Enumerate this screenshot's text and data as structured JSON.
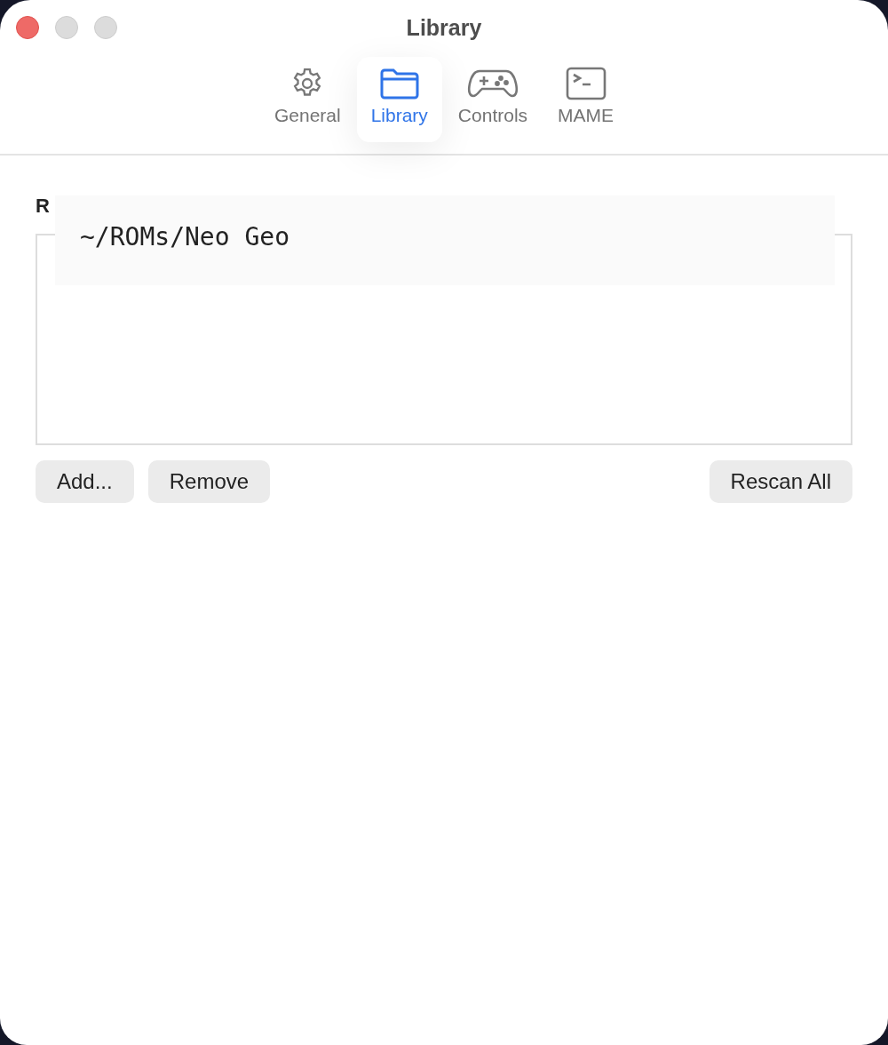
{
  "window": {
    "title": "Library"
  },
  "tabs": [
    {
      "label": "General",
      "selected": false
    },
    {
      "label": "Library",
      "selected": true
    },
    {
      "label": "Controls",
      "selected": false
    },
    {
      "label": "MAME",
      "selected": false
    }
  ],
  "section": {
    "heading": "R"
  },
  "tooltip": {
    "text": "~/ROMs/Neo Geo"
  },
  "left_buttons": [
    "Add...",
    "Remove"
  ],
  "right_buttons": [
    "Rescan All"
  ]
}
